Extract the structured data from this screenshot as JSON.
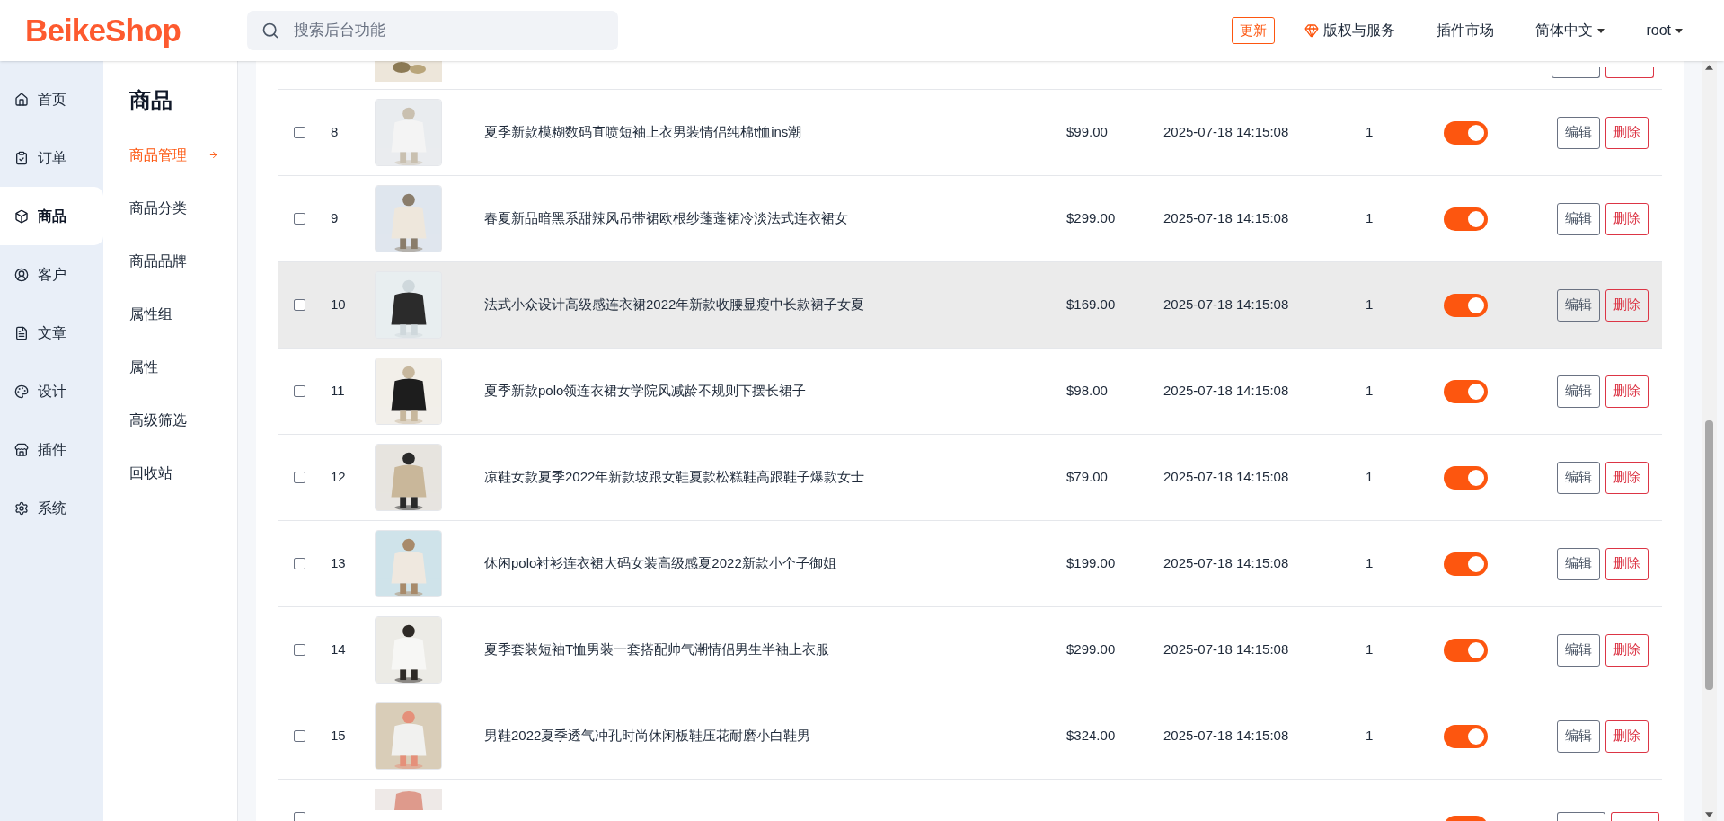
{
  "header": {
    "logo": "BeikeShop",
    "search": {
      "placeholder": "搜索后台功能"
    },
    "update_badge": "更新",
    "links": [
      {
        "kind": "gem",
        "label": "版权与服务"
      },
      {
        "kind": "plain",
        "label": "插件市场"
      },
      {
        "kind": "dropdown",
        "label": "简体中文"
      },
      {
        "kind": "dropdown",
        "label": "root"
      }
    ]
  },
  "main_nav": [
    {
      "label": "首页",
      "selected": false
    },
    {
      "label": "订单",
      "selected": false
    },
    {
      "label": "商品",
      "selected": true
    },
    {
      "label": "客户",
      "selected": false
    },
    {
      "label": "文章",
      "selected": false
    },
    {
      "label": "设计",
      "selected": false
    },
    {
      "label": "插件",
      "selected": false
    },
    {
      "label": "系统",
      "selected": false
    }
  ],
  "sub_nav": {
    "title": "商品",
    "items": [
      {
        "label": "商品管理",
        "selected": true
      },
      {
        "label": "商品分类",
        "selected": false
      },
      {
        "label": "商品品牌",
        "selected": false
      },
      {
        "label": "属性组",
        "selected": false
      },
      {
        "label": "属性",
        "selected": false
      },
      {
        "label": "高级筛选",
        "selected": false
      },
      {
        "label": "回收站",
        "selected": false
      }
    ]
  },
  "table": {
    "rows": [
      {
        "checked": false,
        "id": "8",
        "name": "夏季新款模糊数码直喷短袖上衣男装情侣纯棉t恤ins潮",
        "price": "$99.00",
        "date": "2025-07-18 14:15:08",
        "sort": "1",
        "enabled": true,
        "highlighted": false,
        "edit": "编辑",
        "delete": "删除"
      },
      {
        "checked": false,
        "id": "9",
        "name": "春夏新品暗黑系甜辣风吊带裙欧根纱蓬蓬裙冷淡法式连衣裙女",
        "price": "$299.00",
        "date": "2025-07-18 14:15:08",
        "sort": "1",
        "enabled": true,
        "highlighted": false,
        "edit": "编辑",
        "delete": "删除"
      },
      {
        "checked": false,
        "id": "10",
        "name": "法式小众设计高级感连衣裙2022年新款收腰显瘦中长款裙子女夏",
        "price": "$169.00",
        "date": "2025-07-18 14:15:08",
        "sort": "1",
        "enabled": true,
        "highlighted": true,
        "edit": "编辑",
        "delete": "删除"
      },
      {
        "checked": false,
        "id": "11",
        "name": "夏季新款polo领连衣裙女学院风减龄不规则下摆长裙子",
        "price": "$98.00",
        "date": "2025-07-18 14:15:08",
        "sort": "1",
        "enabled": true,
        "highlighted": false,
        "edit": "编辑",
        "delete": "删除"
      },
      {
        "checked": false,
        "id": "12",
        "name": "凉鞋女款夏季2022年新款坡跟女鞋夏款松糕鞋高跟鞋子爆款女士",
        "price": "$79.00",
        "date": "2025-07-18 14:15:08",
        "sort": "1",
        "enabled": true,
        "highlighted": false,
        "edit": "编辑",
        "delete": "删除"
      },
      {
        "checked": false,
        "id": "13",
        "name": "休闲polo衬衫连衣裙大码女装高级感夏2022新款小个子御姐",
        "price": "$199.00",
        "date": "2025-07-18 14:15:08",
        "sort": "1",
        "enabled": true,
        "highlighted": false,
        "edit": "编辑",
        "delete": "删除"
      },
      {
        "checked": false,
        "id": "14",
        "name": "夏季套装短袖T恤男装一套搭配帅气潮情侣男生半袖上衣服",
        "price": "$299.00",
        "date": "2025-07-18 14:15:08",
        "sort": "1",
        "enabled": true,
        "highlighted": false,
        "edit": "编辑",
        "delete": "删除"
      },
      {
        "checked": false,
        "id": "15",
        "name": "男鞋2022夏季透气冲孔时尚休闲板鞋压花耐磨小白鞋男",
        "price": "$324.00",
        "date": "2025-07-18 14:15:08",
        "sort": "1",
        "enabled": true,
        "highlighted": false,
        "edit": "编辑",
        "delete": "删除"
      }
    ],
    "cut_off_row": {
      "checked": false,
      "enabled": true
    }
  }
}
